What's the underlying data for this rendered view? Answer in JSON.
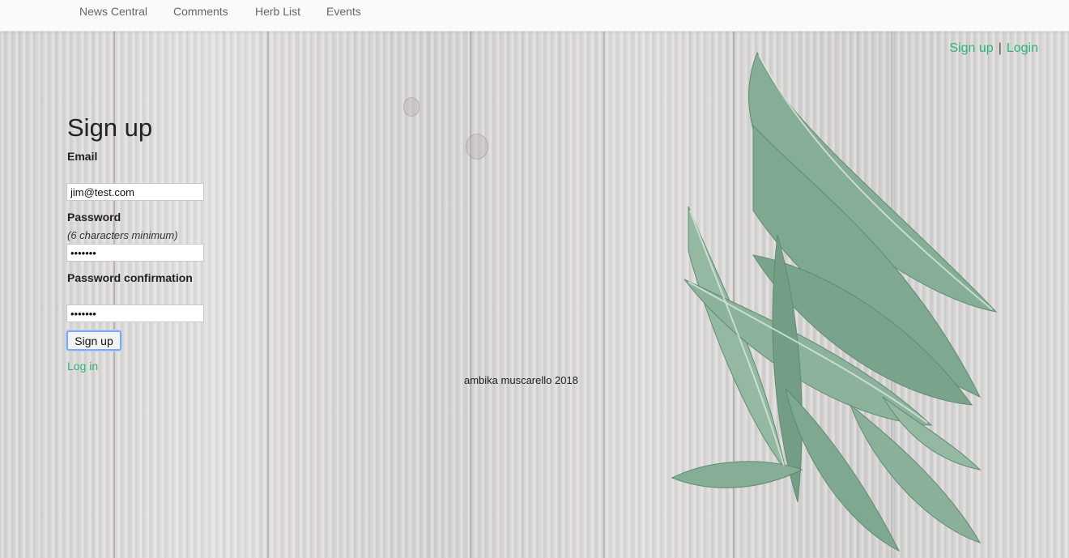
{
  "nav": {
    "items": [
      "News Central",
      "Comments",
      "Herb List",
      "Events"
    ]
  },
  "auth": {
    "signup_label": "Sign up",
    "separator": "|",
    "login_label": "Login"
  },
  "form": {
    "title": "Sign up",
    "email_label": "Email",
    "email_value": "jim@test.com",
    "password_label": "Password",
    "password_hint": "(6 characters minimum)",
    "password_value": "•••••••",
    "confirm_label": "Password confirmation",
    "confirm_value": "•••••••",
    "submit_label": "Sign up",
    "login_link": "Log in"
  },
  "footer": {
    "text": "ambika muscarello 2018"
  },
  "colors": {
    "link": "#2cb37a",
    "leaf": "#7fa890"
  }
}
